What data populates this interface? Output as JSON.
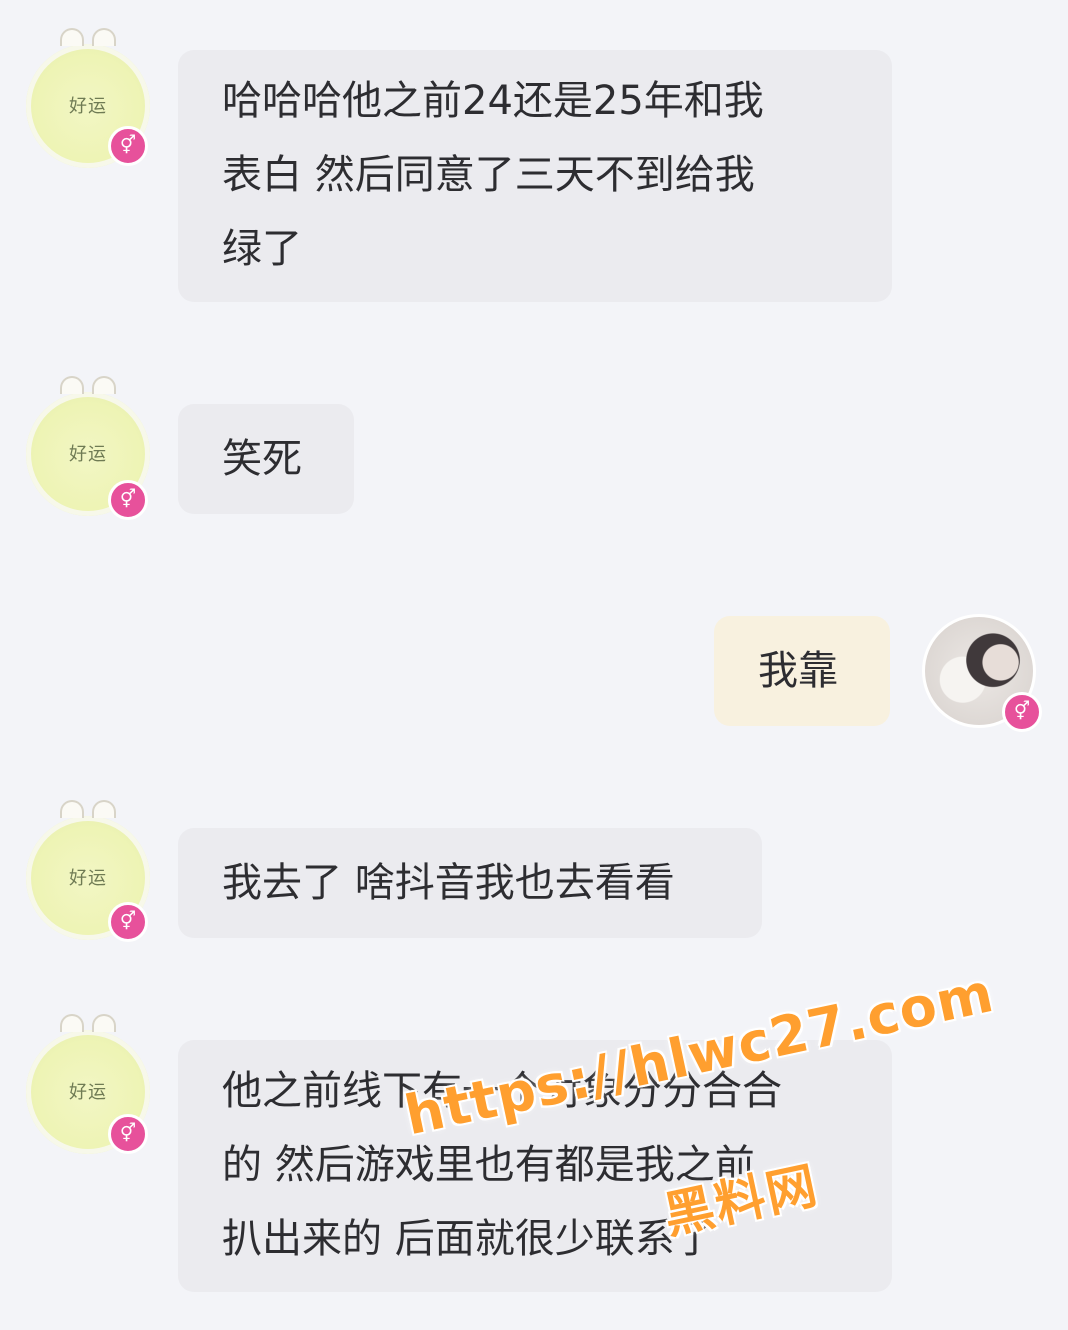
{
  "theme": {
    "left_bubble_color": "#ebebef",
    "right_bubble_color": "#f8f1df",
    "badge_color": "#e7519b",
    "watermark_color": "#ff9f2f"
  },
  "avatars": {
    "lemon_text": "好运",
    "badge_symbol": "⚥"
  },
  "messages": [
    {
      "side": "left",
      "lines": [
        "哈哈哈他之前24还是25年和我",
        "表白 然后同意了三天不到给我",
        "绿了"
      ]
    },
    {
      "side": "left",
      "lines": [
        "笑死"
      ]
    },
    {
      "side": "right",
      "lines": [
        "我靠"
      ]
    },
    {
      "side": "left",
      "lines": [
        "我去了 啥抖音我也去看看"
      ]
    },
    {
      "side": "left",
      "lines": [
        "他之前线下有一个对象分分合合",
        "的 然后游戏里也有都是我之前",
        "扒出来的 后面就很少联系了"
      ]
    }
  ],
  "watermark": {
    "url": "https://hlwc27.com",
    "name": "黑料网"
  }
}
